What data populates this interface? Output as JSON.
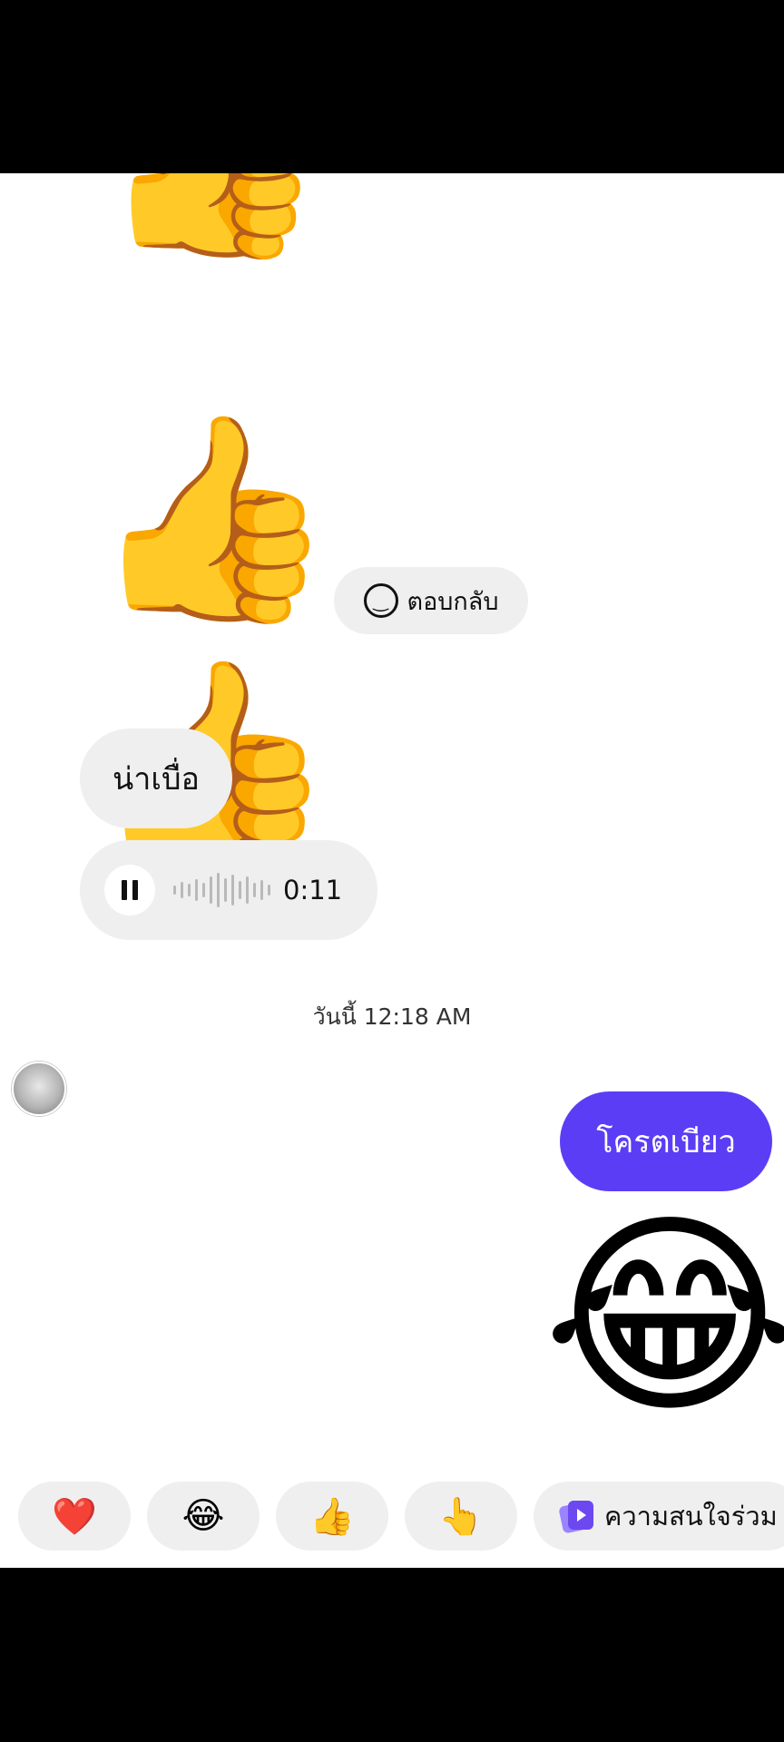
{
  "messages": {
    "emoji_partial": "👍",
    "emoji_thumb_1": "👍",
    "emoji_thumb_2": "👍",
    "reply_label": "ตอบกลับ",
    "incoming_text": "น่าเบื่อ",
    "voice_duration": "0:11",
    "timestamp": "วันนี้ 12:18 AM",
    "outgoing_text": "โครตเบียว",
    "outgoing_emoji": "😂"
  },
  "quick_reactions": [
    "❤️",
    "😂",
    "👍",
    "👆"
  ],
  "interest_chip_label": "ความสนใจร่วม",
  "colors": {
    "outgoing_bubble": "#5b3df5",
    "incoming_bubble": "#efefef",
    "background": "#ffffff"
  }
}
